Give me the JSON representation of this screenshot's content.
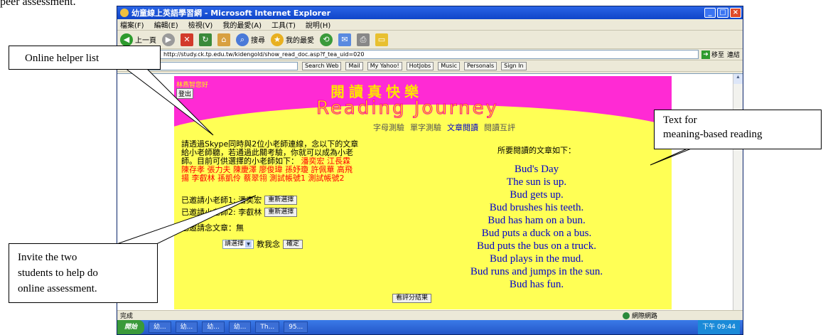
{
  "top_caption": "peer assessment.",
  "window": {
    "title": "幼童線上英語學習網 - Microsoft Internet Explorer",
    "menu": [
      "檔案(F)",
      "編輯(E)",
      "檢視(V)",
      "我的最愛(A)",
      "工具(T)",
      "說明(H)"
    ],
    "toolbar": {
      "back": "上一頁",
      "search": "搜尋",
      "favorites": "我的最愛"
    },
    "address_url": "http://study.ck.tp.edu.tw/kidengold/show_read_doc.asp?f_tea_uid=020",
    "go_label": "移至",
    "links_label": "連結",
    "searchbar": [
      "Search Web",
      "Mail",
      "My Yahoo!",
      "HotJobs",
      "Music",
      "Personals",
      "Sign In"
    ],
    "status_left": "完成",
    "status_zone": "網際網路",
    "taskbar": {
      "start": "開始",
      "tasks": [
        "幼...",
        "幼...",
        "幼...",
        "幼...",
        "Th...",
        "95..."
      ],
      "clock": "下午 09:44"
    }
  },
  "page": {
    "greeting": "林燕智您好",
    "logout": "登出",
    "title_cn": "閱讀真快樂",
    "title_en": "Reading Journey",
    "nav": [
      "字母測驗",
      "單字測驗",
      "文章閱讀",
      "閱讀互評"
    ],
    "nav_active_index": 2,
    "instructions": "請透過Skype同時與2位小老師連線，念以下的文章給小老師聽，若通過此關考驗，你就可以成為小老師。目前可供選擇的小老師如下：",
    "helpers": "潘奕宏 江長霖 陳存孝 張力夫 陳慶澤 廖俊瑋 孫妤瓊 許佩華 高飛揚 李叡林 孫凱伶 蔡翠翎 測試帳號1 測試帳號2",
    "invite1_label": "已邀請小老師1: 潘奕宏",
    "invite2_label": "已邀請小老師2: 李叡林",
    "reselect_label": "重新選擇",
    "invited_reader_label": "已邀請念文章：無",
    "select_value": "請選擇",
    "teach_me_label": "教我念",
    "confirm_label": "確定",
    "story_intro": "所要閱讀的文章如下：",
    "story_title": "Bud's Day",
    "story_lines": [
      "The sun is up.",
      "Bud gets up.",
      "Bud brushes his teeth.",
      "Bud has ham on a bun.",
      "Bud puts a duck on a bus.",
      "Bud puts the bus on a truck.",
      "Bud plays in the mud.",
      "Bud runs and jumps in the sun.",
      "Bud has fun."
    ],
    "result_button": "看評分結果"
  },
  "callouts": {
    "helper_list": "Online helper list",
    "meaning_text": [
      "Text for",
      "meaning-based reading"
    ],
    "invite": [
      "Invite the two",
      "students to help do",
      "online assessment."
    ]
  }
}
